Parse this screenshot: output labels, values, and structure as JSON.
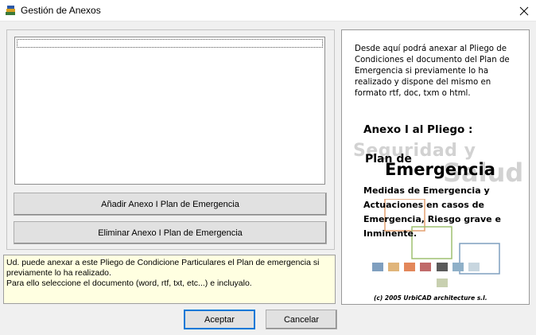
{
  "window": {
    "title": "Gestión de Anexos"
  },
  "list": {
    "items": []
  },
  "buttons": {
    "add_label": "Añadir Anexo I Plan de Emergencia",
    "remove_label": "Eliminar Anexo I Plan de Emergencia",
    "ok_label": "Aceptar",
    "cancel_label": "Cancelar"
  },
  "info": {
    "line1": "Ud. puede anexar a este Pliego de Condicione Particulares el Plan de emergencia si",
    "line2": "previamente lo ha realizado.",
    "line3": "Para ello seleccione el documento (word, rtf, txt, etc...) e incluyalo."
  },
  "panel": {
    "description": "Desde aquí podrá anexar al Pliego de Condiciones el documento del Plan de Emergencia si previamente lo ha realizado y dispone del mismo en formato rtf, doc, txm o html.",
    "heading": "Anexo I al Pliego :",
    "watermark_1": "Seguridad y",
    "watermark_2": "Salud",
    "plan_de": "Plan de",
    "emergencia": "Emergencia",
    "medidas_1": "Medidas de Emergencia y",
    "medidas_2": "Actuaciones en casos de",
    "medidas_3": "Emergencia, Riesgo grave e",
    "medidas_4": "Inminente.",
    "copyright": "(c) 2005 UrbiCAD architecture s.l."
  },
  "colors": {
    "info_background": "#ffffe1",
    "decor_squares": [
      "#7f9fbf",
      "#e0b57a",
      "#e3875a",
      "#c06a6a",
      "#5a5a5a",
      "#8fb0c8",
      "#c8d6df"
    ]
  },
  "icons": {
    "app": "books-icon",
    "close": "close-icon"
  }
}
